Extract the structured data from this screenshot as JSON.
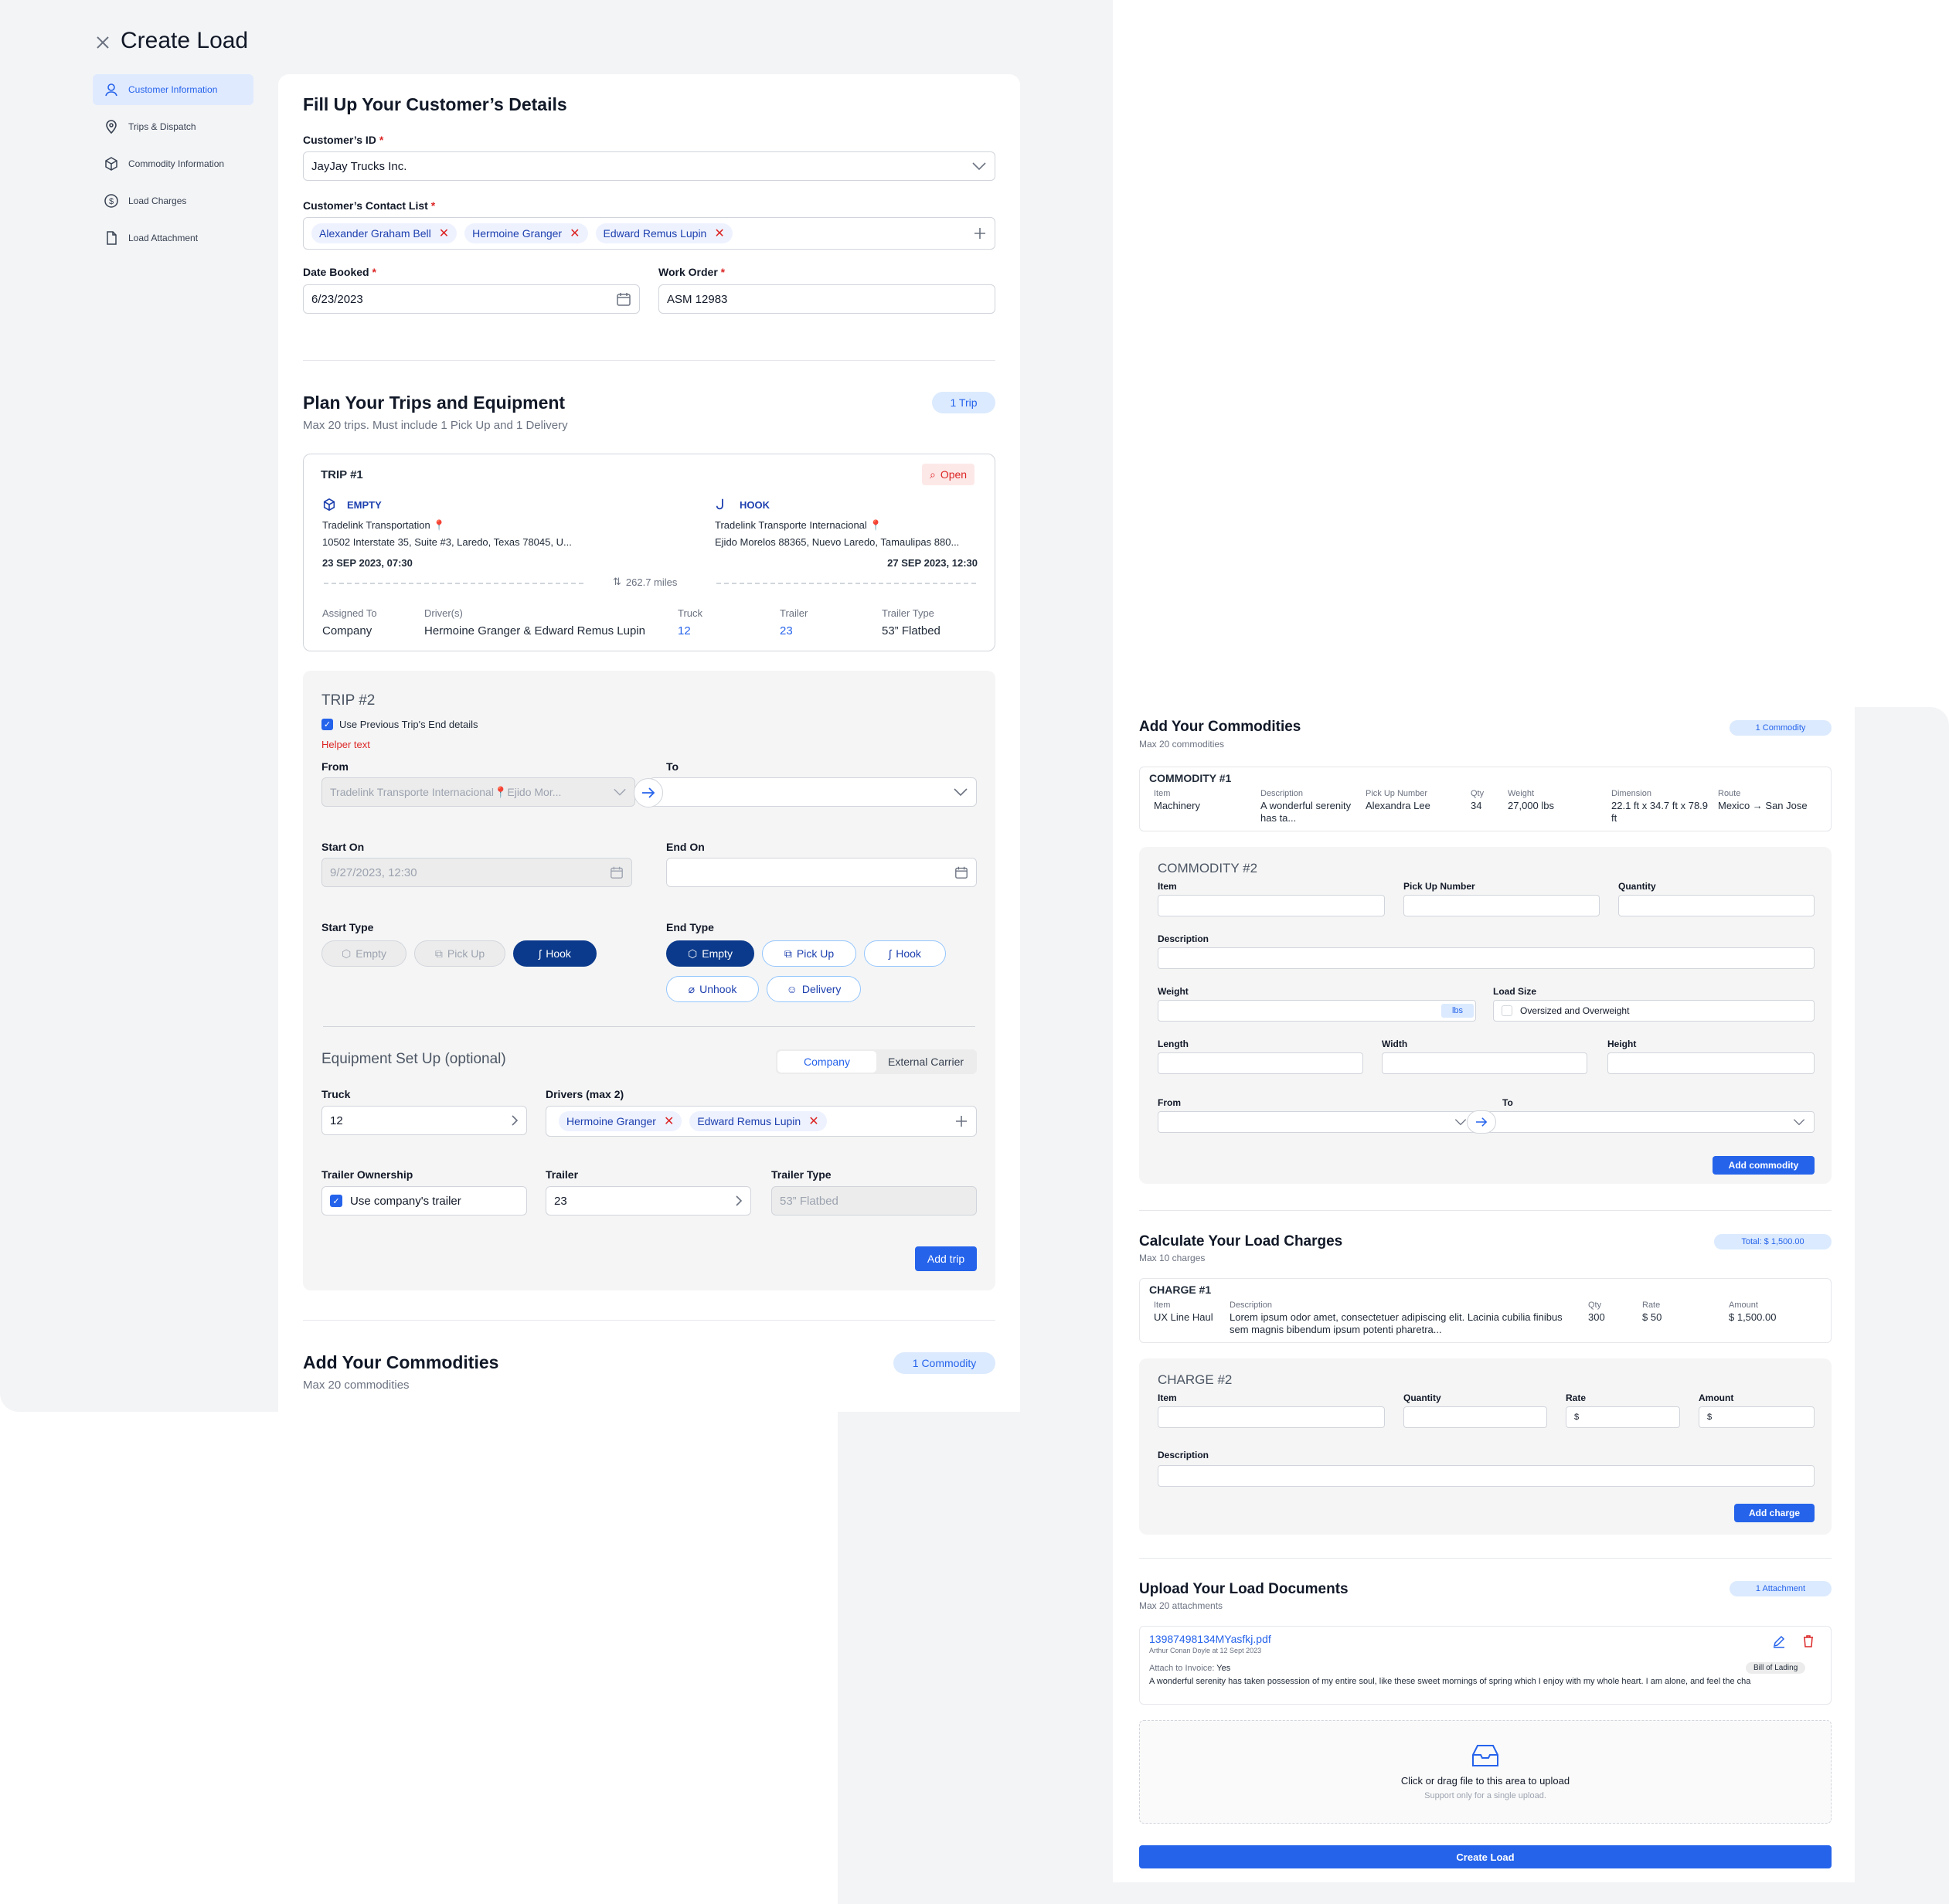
{
  "header": {
    "title": "Create Load"
  },
  "sidebar": {
    "items": [
      {
        "label": "Customer Information"
      },
      {
        "label": "Trips & Dispatch"
      },
      {
        "label": "Commodity Information"
      },
      {
        "label": "Load Charges"
      },
      {
        "label": "Load Attachment"
      }
    ]
  },
  "customer": {
    "title": "Fill Up Your Customer’s Details",
    "id_label": "Customer’s ID",
    "id_value": "JayJay Trucks Inc.",
    "contacts_label": "Customer’s Contact List",
    "contacts": [
      "Alexander Graham Bell",
      "Hermoine Granger",
      "Edward Remus Lupin"
    ],
    "date_label": "Date Booked",
    "date_value": "6/23/2023",
    "wo_label": "Work Order",
    "wo_value": "ASM 12983",
    "req": "*"
  },
  "trips": {
    "title": "Plan Your Trips and Equipment",
    "subtitle": "Max 20 trips. Must include 1 Pick Up and 1 Delivery",
    "badge": "1 Trip",
    "trip1": {
      "title": "TRIP #1",
      "status": "Open",
      "start_type": "EMPTY",
      "start_company": "Tradelink Transportation",
      "start_address": "10502 Interstate 35, Suite #3, Laredo, Texas 78045, U...",
      "start_date": "23 SEP 2023, 07:30",
      "end_type": "HOOK",
      "end_company": "Tradelink Transporte Internacional",
      "end_address": "Ejido Morelos 88365, Nuevo Laredo, Tamaulipas 880...",
      "end_date": "27 SEP 2023, 12:30",
      "miles": "262.7 miles",
      "assigned_label": "Assigned To",
      "assigned_value": "Company",
      "drivers_label": "Driver(s)",
      "drivers_value": "Hermoine Granger & Edward Remus Lupin",
      "truck_label": "Truck",
      "truck_value": "12",
      "trailer_label": "Trailer",
      "trailer_value": "23",
      "trailer_type_label": "Trailer Type",
      "trailer_type_value": "53” Flatbed"
    },
    "trip2": {
      "title": "TRIP #2",
      "use_prev": "Use Previous Trip's End details",
      "helper": "Helper text",
      "from_label": "From",
      "from_value": "Tradelink Transporte Internacional",
      "from_value2": "Ejido Mor...",
      "to_label": "To",
      "start_on_label": "Start On",
      "start_on_value": "9/27/2023, 12:30",
      "end_on_label": "End On",
      "start_type_label": "Start Type",
      "end_type_label": "End Type",
      "types": {
        "empty": "Empty",
        "pickup": "Pick Up",
        "hook": "Hook",
        "unhook": "Unhook",
        "delivery": "Delivery"
      },
      "equip_title": "Equipment Set Up (optional)",
      "seg_company": "Company",
      "seg_external": "External Carrier",
      "truck_label": "Truck",
      "truck_value": "12",
      "drivers_label": "Drivers (max 2)",
      "drivers": [
        "Hermoine Granger",
        "Edward Remus Lupin"
      ],
      "ownership_label": "Trailer Ownership",
      "ownership_value": "Use company's trailer",
      "trailer_label": "Trailer",
      "trailer_value": "23",
      "trailer_type_label": "Trailer Type",
      "trailer_type_value": "53” Flatbed",
      "add_trip": "Add trip"
    }
  },
  "commodities": {
    "title": "Add Your Commodities",
    "subtitle": "Max 20 commodities",
    "badge": "1 Commodity",
    "c1": {
      "title": "COMMODITY #1",
      "item_label": "Item",
      "item": "Machinery",
      "desc_label": "Description",
      "desc": "A wonderful serenity has ta...",
      "pick_label": "Pick Up Number",
      "pick": "Alexandra Lee",
      "qty_label": "Qty",
      "qty": "34",
      "weight_label": "Weight",
      "weight": "27,000 lbs",
      "dim_label": "Dimension",
      "dim": "22.1 ft x 34.7 ft x 78.9 ft",
      "route_label": "Route",
      "route": "Mexico → San Jose"
    },
    "c2": {
      "title": "COMMODITY #2",
      "item_label": "Item",
      "pick_label": "Pick Up Number",
      "qty_label": "Quantity",
      "desc_label": "Description",
      "weight_label": "Weight",
      "weight_unit": "lbs",
      "size_label": "Load Size",
      "size_option": "Oversized and Overweight",
      "length_label": "Length",
      "width_label": "Width",
      "height_label": "Height",
      "from_label": "From",
      "to_label": "To",
      "add": "Add commodity"
    }
  },
  "charges": {
    "title": "Calculate Your Load Charges",
    "subtitle": "Max 10 charges",
    "badge": "Total: $ 1,500.00",
    "ch1": {
      "title": "CHARGE #1",
      "item_label": "Item",
      "item": "UX Line Haul",
      "desc_label": "Description",
      "desc": "Lorem ipsum odor amet, consectetuer adipiscing elit. Lacinia cubilia finibus sem magnis bibendum ipsum potenti pharetra...",
      "qty_label": "Qty",
      "qty": "300",
      "rate_label": "Rate",
      "rate": "$ 50",
      "amount_label": "Amount",
      "amount": "$ 1,500.00"
    },
    "ch2": {
      "title": "CHARGE #2",
      "item_label": "Item",
      "qty_label": "Quantity",
      "rate_label": "Rate",
      "amount_label": "Amount",
      "currency": "$",
      "desc_label": "Description",
      "add": "Add charge"
    }
  },
  "documents": {
    "title": "Upload Your Load Documents",
    "subtitle": "Max 20 attachments",
    "badge": "1 Attachment",
    "file": {
      "name": "13987498134MYasfkj.pdf",
      "meta": "Arthur Conan Doyle at 12 Sept 2023",
      "invoice_label": "Attach to Invoice:",
      "invoice_value": "Yes",
      "tag": "Bill of Lading",
      "desc": "A wonderful serenity has taken possession of my entire soul, like these sweet mornings of spring which I enjoy with my whole heart. I am alone, and feel the cha"
    },
    "upload_text": "Click or drag file to this area to upload",
    "upload_hint": "Support only for a single upload."
  },
  "footer": {
    "create": "Create Load"
  },
  "colors": {
    "primary": "#2563eb",
    "navy": "#0b3a8c",
    "danger": "#dc2626",
    "badge": "#dbeafe"
  }
}
